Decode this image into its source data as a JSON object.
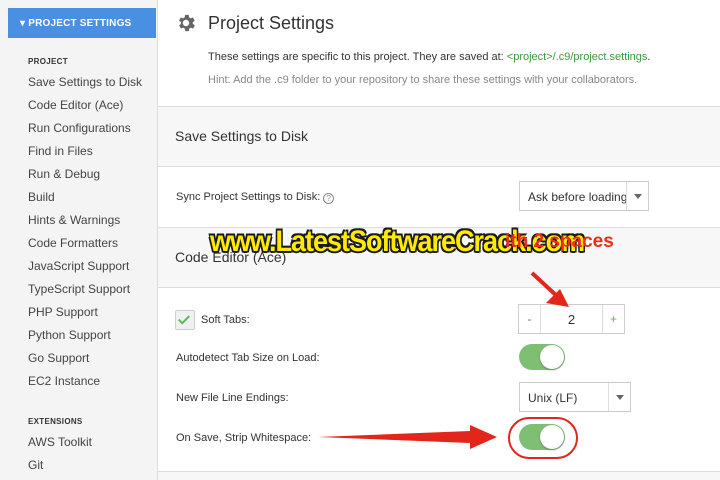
{
  "sidebar": {
    "header": "▾ PROJECT SETTINGS",
    "groups": [
      {
        "label": "PROJECT",
        "items": [
          "Save Settings to Disk",
          "Code Editor (Ace)",
          "Run Configurations",
          "Find in Files",
          "Run & Debug",
          "Build",
          "Hints & Warnings",
          "Code Formatters",
          "JavaScript Support",
          "TypeScript Support",
          "PHP Support",
          "Python Support",
          "Go Support",
          "EC2 Instance"
        ]
      },
      {
        "label": "EXTENSIONS",
        "items": [
          "AWS Toolkit",
          "Git"
        ]
      }
    ]
  },
  "main": {
    "title": "Project Settings",
    "icon": "gear-icon",
    "description_prefix": "These settings are specific to this project. They are saved at: ",
    "description_path": "<project>/.c9/project.settings",
    "description_suffix": ".",
    "hint": "Hint: Add the .c9 folder to your repository to share these settings with your collaborators.",
    "sections": {
      "save_settings": {
        "heading": "Save Settings to Disk",
        "sync_label": "Sync Project Settings to Disk:",
        "sync_help": "?",
        "sync_value": "Ask before loading"
      },
      "code_editor": {
        "heading": "Code Editor (Ace)",
        "soft_tabs_label": "Soft Tabs:",
        "soft_tabs_checked": true,
        "minus": "-",
        "plus": "+",
        "tab_size": "2",
        "autodetect_label": "Autodetect Tab Size on Load:",
        "autodetect_on": true,
        "line_endings_label": "New File Line Endings:",
        "line_endings_value": "Unix (LF)",
        "strip_whitespace_label": "On Save, Strip Whitespace:",
        "strip_whitespace_on": true
      }
    }
  },
  "overlay": {
    "watermark": "www.LatestSoftwareCrack.com",
    "callout": "ith 2 spaces",
    "colors": {
      "arrow": "#e3261b",
      "watermark": "#ffea00"
    }
  },
  "colors": {
    "accent": "#4a90e2",
    "toggle_on": "#7fbf74",
    "check": "#5cb85c",
    "path": "#3a9a3a"
  }
}
